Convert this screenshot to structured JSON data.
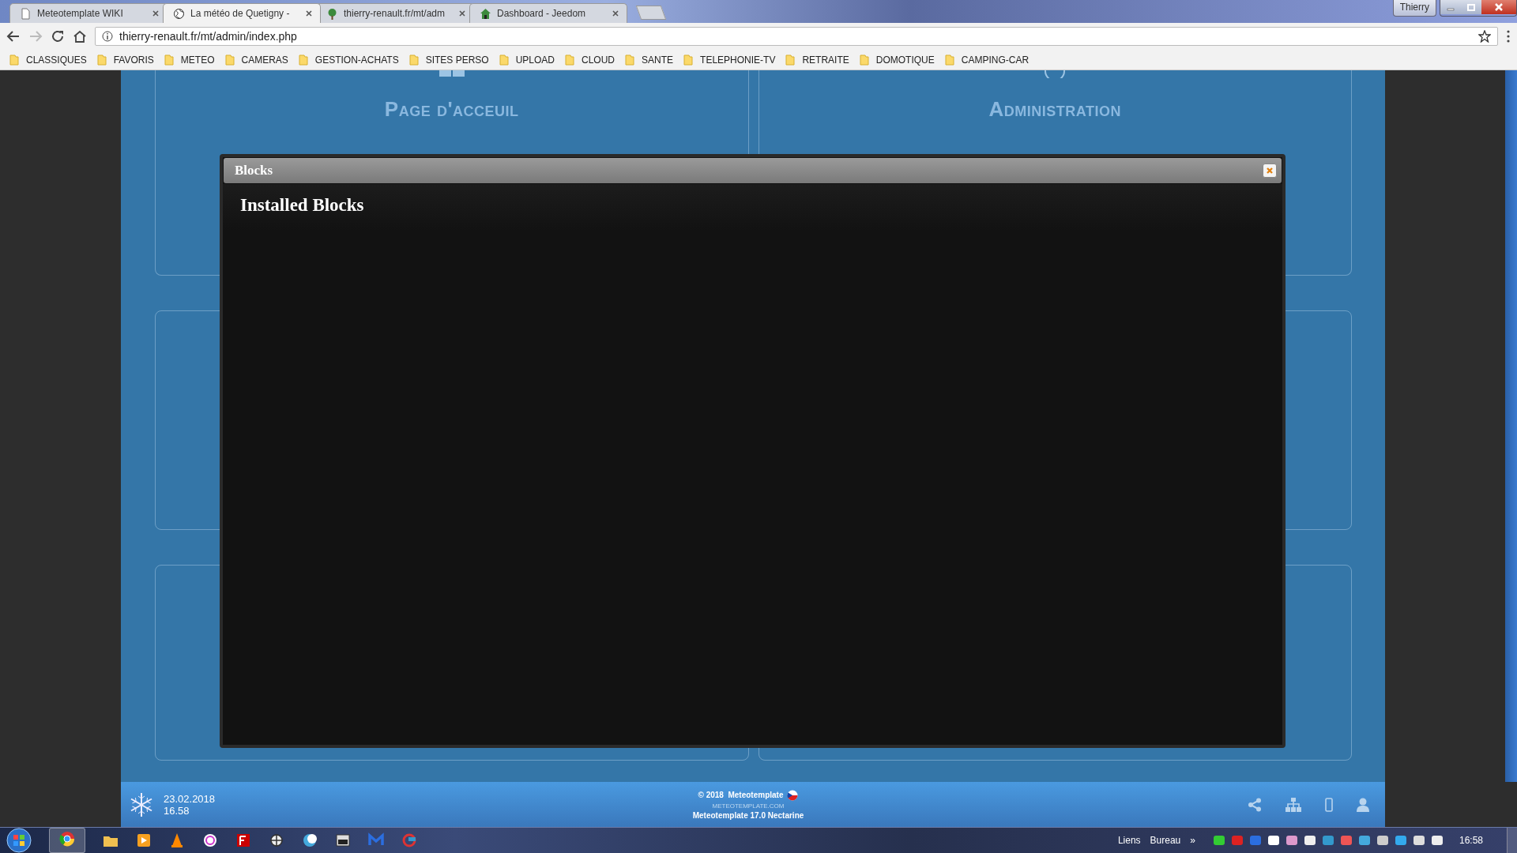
{
  "browser": {
    "tabs": [
      {
        "title": "Meteotemplate WIKI",
        "selected": false
      },
      {
        "title": "La météo de Quetigny -",
        "selected": true
      },
      {
        "title": "thierry-renault.fr/mt/adm",
        "selected": false
      },
      {
        "title": "Dashboard - Jeedom",
        "selected": false
      }
    ],
    "user": "Thierry",
    "url": "thierry-renault.fr/mt/admin/index.php",
    "bookmarks": [
      "CLASSIQUES",
      "FAVORIS",
      "METEO",
      "CAMERAS",
      "GESTION-ACHATS",
      "SITES PERSO",
      "UPLOAD",
      "CLOUD",
      "SANTE",
      "TELEPHONIE-TV",
      "RETRAITE",
      "DOMOTIQUE",
      "CAMPING-CAR"
    ]
  },
  "page": {
    "sections": [
      {
        "title": "Page d'acceuil"
      },
      {
        "title": "Administration"
      }
    ],
    "footer": {
      "date": "23.02.2018",
      "time": "16.58",
      "copyright": "© 2018  Meteotemplate",
      "site": "METEOTEMPLATE.COM",
      "version": "Meteotemplate 17.0 Nectarine"
    }
  },
  "modal": {
    "title": "Blocks",
    "heading": "Installed Blocks"
  },
  "taskbar": {
    "toolbars": [
      "Liens",
      "Bureau"
    ],
    "overflow": "»",
    "clock": "16:58"
  }
}
